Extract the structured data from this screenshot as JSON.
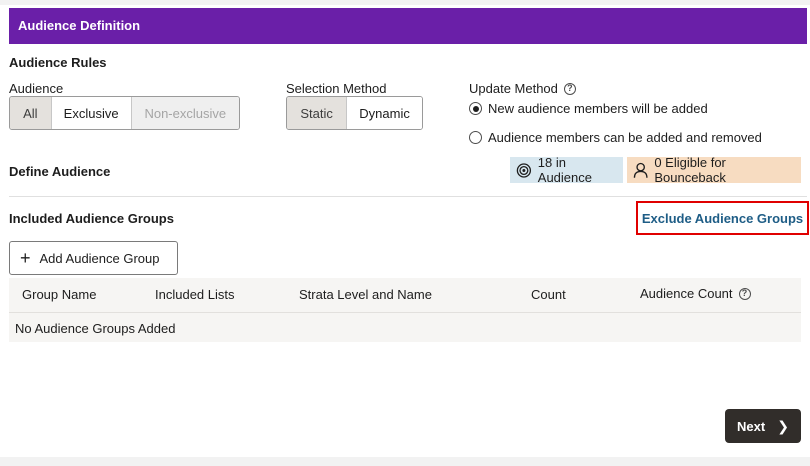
{
  "header": {
    "title": "Audience Definition",
    "bg_color": "#6a1fa8"
  },
  "audience_rules": {
    "title": "Audience Rules",
    "audience": {
      "label": "Audience",
      "options": [
        {
          "label": "All",
          "state": "unselected"
        },
        {
          "label": "Exclusive",
          "state": "selected"
        },
        {
          "label": "Non-exclusive",
          "state": "disabled"
        }
      ]
    },
    "selection_method": {
      "label": "Selection Method",
      "options": [
        {
          "label": "Static",
          "state": "unselected"
        },
        {
          "label": "Dynamic",
          "state": "selected"
        }
      ]
    },
    "update_method": {
      "label": "Update Method",
      "help_icon": "help-icon",
      "options": [
        {
          "label": "New audience members will be added",
          "checked": true
        },
        {
          "label": "Audience members can be added and removed",
          "checked": false
        }
      ]
    }
  },
  "define_audience": {
    "title": "Define Audience",
    "in_audience": "18 in Audience",
    "eligible_bounceback": "0 Eligible for Bounceback"
  },
  "included_groups": {
    "title": "Included Audience Groups",
    "exclude_link": "Exclude Audience Groups",
    "add_button": "Add Audience Group",
    "columns": [
      "Group Name",
      "Included Lists",
      "Strata Level and Name",
      "Count",
      "Audience Count"
    ],
    "empty_message": "No Audience Groups Added"
  },
  "footer": {
    "next_label": "Next"
  },
  "colors": {
    "link": "#1e5d86",
    "highlight_border": "#e00000",
    "next_button": "#312d2a"
  }
}
